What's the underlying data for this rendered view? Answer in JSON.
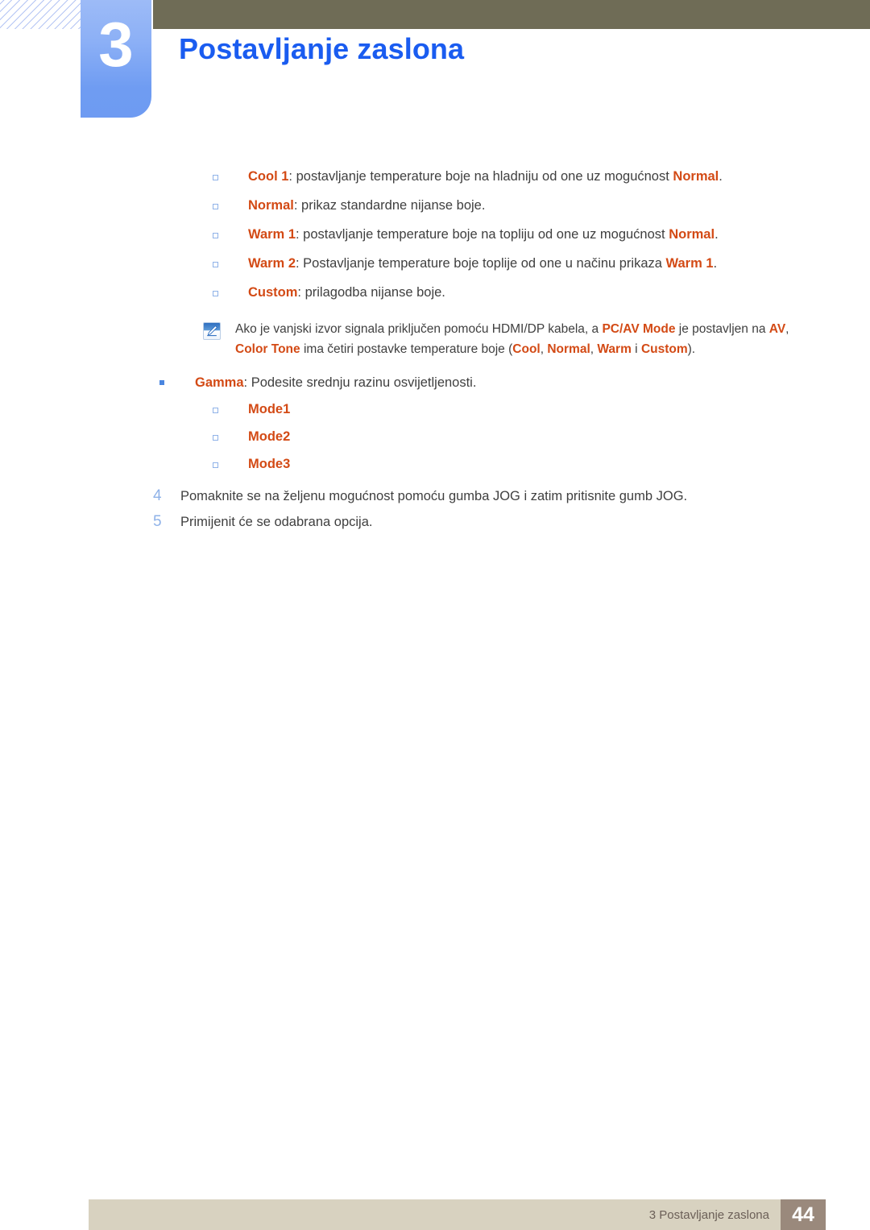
{
  "header": {
    "chapter_number": "3",
    "chapter_title": "Postavljanje zaslona",
    "bar_color": "#6f6c56",
    "badge_color": "#7da4f4",
    "title_color": "#1a5cf0"
  },
  "colors": {
    "emphasis": "#d34a15",
    "body_text": "#3f3f3f",
    "step_number": "#8fb2e8",
    "footer_bar": "#d8d2c0",
    "footer_page_box": "#9a897c"
  },
  "color_tone_options": [
    {
      "term": "Cool 1",
      "body_1": ": postavljanje temperature boje na hladniju od one uz mogućnost ",
      "term_2": "Normal",
      "body_2": "."
    },
    {
      "term": "Normal",
      "body_1": ": prikaz standardne nijanse boje.",
      "term_2": "",
      "body_2": ""
    },
    {
      "term": "Warm 1",
      "body_1": ": postavljanje temperature boje na topliju od one uz mogućnost ",
      "term_2": "Normal",
      "body_2": "."
    },
    {
      "term": "Warm 2",
      "body_1": ": Postavljanje temperature boje toplije od one u načinu prikaza ",
      "term_2": "Warm 1",
      "body_2": "."
    },
    {
      "term": "Custom",
      "body_1": ": prilagodba nijanse boje.",
      "term_2": "",
      "body_2": ""
    }
  ],
  "note": {
    "icon": "note-pencil-icon",
    "line1_a": "Ako je vanjski izvor signala priključen pomoću HDMI/DP kabela, a ",
    "line1_term": "PC/AV Mode",
    "line1_b": " je postavljen na ",
    "line1_term2": "AV",
    "line1_c": ", ",
    "line1_term3": "Color Tone",
    "line1_d": " ima četiri postavke temperature boje (",
    "opt1": "Cool",
    "sep1": ", ",
    "opt2": "Normal",
    "sep2": ", ",
    "opt3": "Warm",
    "sep3": " i ",
    "opt4": "Custom",
    "line1_end": ")."
  },
  "gamma": {
    "term": "Gamma",
    "body": ": Podesite srednju razinu osvijetljenosti.",
    "modes": [
      "Mode1",
      "Mode2",
      "Mode3"
    ]
  },
  "steps": [
    {
      "number": "4",
      "text": "Pomaknite se na željenu mogućnost pomoću gumba JOG i zatim pritisnite gumb JOG."
    },
    {
      "number": "5",
      "text": "Primijenit će se odabrana opcija."
    }
  ],
  "footer": {
    "label": "3 Postavljanje zaslona",
    "page": "44"
  }
}
